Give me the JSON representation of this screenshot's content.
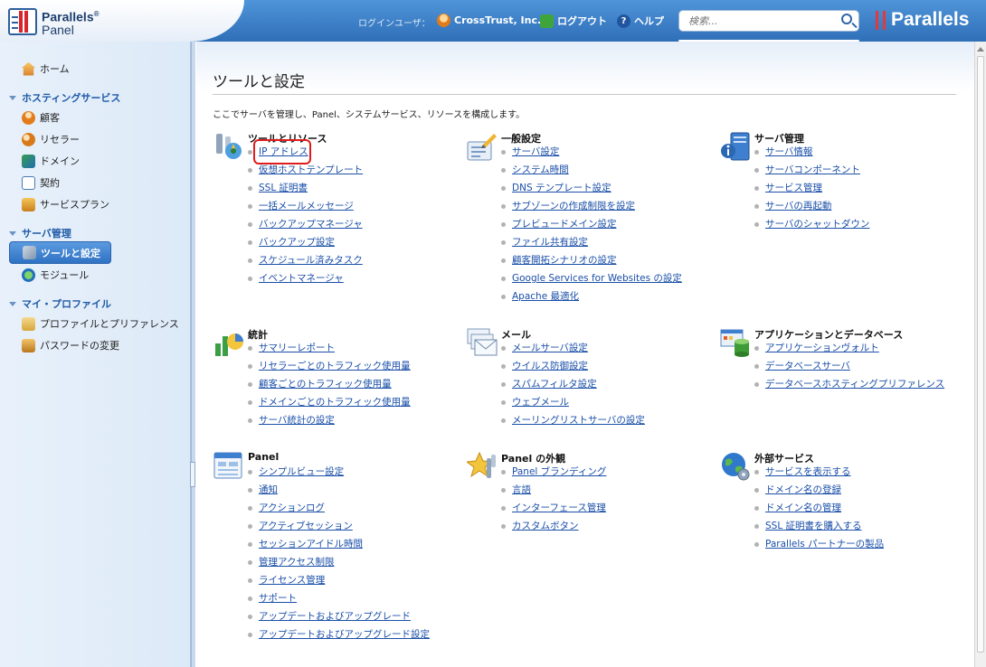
{
  "header": {
    "logo_line1": "Parallels",
    "logo_line2": "Panel",
    "login_label": "ログインユーザ：",
    "user_name": "CrossTrust, Inc.",
    "logout": "ログアウト",
    "help": "ヘルプ",
    "search_placeholder": "検索...",
    "brand": "Parallels"
  },
  "sidebar": {
    "home": "ホーム",
    "groups": [
      {
        "title": "ホスティングサービス",
        "items": [
          "顧客",
          "リセラー",
          "ドメイン",
          "契約",
          "サービスプラン"
        ]
      },
      {
        "title": "サーバ管理",
        "items": [
          "ツールと設定",
          "モジュール"
        ]
      },
      {
        "title": "マイ・プロファイル",
        "items": [
          "プロファイルとプリファレンス",
          "パスワードの変更"
        ]
      }
    ],
    "active_item": "ツールと設定"
  },
  "main": {
    "title": "ツールと設定",
    "intro": "ここでサーバを管理し、Panel、システムサービス、リソースを構成します。",
    "sections": [
      {
        "title": "ツールとリソース",
        "icon": "tools-icon",
        "links": [
          "IP アドレス",
          "仮想ホストテンプレート",
          "SSL 証明書",
          "一括メールメッセージ",
          "バックアップマネージャ",
          "バックアップ設定",
          "スケジュール済みタスク",
          "イベントマネージャ"
        ]
      },
      {
        "title": "一般設定",
        "icon": "settings-icon",
        "links": [
          "サーバ設定",
          "システム時間",
          "DNS テンプレート設定",
          "サブゾーンの作成制限を設定",
          "プレビュードメイン設定",
          "ファイル共有設定",
          "顧客開拓シナリオの設定",
          "Google Services for Websites の設定",
          "Apache 最適化"
        ]
      },
      {
        "title": "サーバ管理",
        "icon": "server-icon",
        "links": [
          "サーバ情報",
          "サーバコンポーネント",
          "サービス管理",
          "サーバの再起動",
          "サーバのシャットダウン"
        ]
      },
      {
        "title": "統計",
        "icon": "statistics-icon",
        "links": [
          "サマリーレポート",
          "リセラーごとのトラフィック使用量",
          "顧客ごとのトラフィック使用量",
          "ドメインごとのトラフィック使用量",
          "サーバ統計の設定"
        ]
      },
      {
        "title": "メール",
        "icon": "mail-icon",
        "links": [
          "メールサーバ設定",
          "ウイルス防御設定",
          "スパムフィルタ設定",
          "ウェブメール",
          "メーリングリストサーバの設定"
        ]
      },
      {
        "title": "アプリケーションとデータベース",
        "icon": "database-icon",
        "links": [
          "アプリケーションヴォルト",
          "データベースサーバ",
          "データベースホスティングプリファレンス"
        ]
      },
      {
        "title": "Panel",
        "icon": "panel-icon",
        "links": [
          "シンプルビュー設定",
          "通知",
          "アクションログ",
          "アクティブセッション",
          "セッションアイドル時間",
          "管理アクセス制限",
          "ライセンス管理",
          "サポート",
          "アップデートおよびアップグレード",
          "アップデートおよびアップグレード設定"
        ]
      },
      {
        "title": "Panel の外観",
        "icon": "appearance-icon",
        "links": [
          "Panel ブランディング",
          "言語",
          "インターフェース管理",
          "カスタムボタン"
        ]
      },
      {
        "title": "外部サービス",
        "icon": "globe-icon",
        "links": [
          "サービスを表示する",
          "ドメイン名の登録",
          "ドメイン名の管理",
          "SSL 証明書を購入する",
          "Parallels パートナーの製品"
        ]
      }
    ]
  },
  "colors": {
    "header": "#2f6fb8",
    "link": "#1a4fa8",
    "highlight": "#e01b1b",
    "active_nav": "#3a7fd0"
  }
}
